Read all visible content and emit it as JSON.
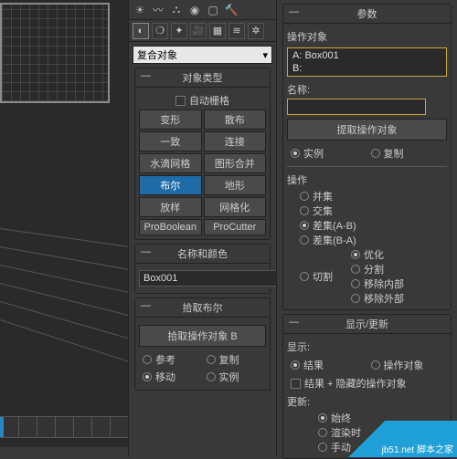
{
  "dropdown": {
    "label": "复合对象"
  },
  "objectType": {
    "title": "对象类型",
    "autogrid": "自动栅格",
    "buttons": [
      "变形",
      "散布",
      "一致",
      "连接",
      "水滴网格",
      "图形合并",
      "布尔",
      "地形",
      "放样",
      "网格化",
      "ProBoolean",
      "ProCutter"
    ]
  },
  "nameColor": {
    "title": "名称和颜色",
    "value": "Box001"
  },
  "pickBool": {
    "title": "拾取布尔",
    "btn": "拾取操作对象 B",
    "opts": [
      "参考",
      "复制",
      "移动",
      "实例"
    ]
  },
  "params": {
    "title": "参数",
    "opObj": "操作对象",
    "list": [
      "A: Box001",
      "B:"
    ],
    "nameLbl": "名称:",
    "extractBtn": "提取操作对象",
    "extractOpts": [
      "实例",
      "复制"
    ]
  },
  "operation": {
    "title": "操作",
    "opts": [
      "并集",
      "交集",
      "差集(A-B)",
      "差集(B-A)",
      "切割"
    ],
    "cutOpts": [
      "优化",
      "分割",
      "移除内部",
      "移除外部"
    ]
  },
  "display": {
    "title": "显示/更新",
    "showLbl": "显示:",
    "showOpts": [
      "结果",
      "操作对象"
    ],
    "hiddenOpt": "结果 + 隐藏的操作对象",
    "updateLbl": "更新:",
    "updateOpts": [
      "始终",
      "渲染时",
      "手动"
    ]
  },
  "watermark": "jb51.net   脚本之家"
}
